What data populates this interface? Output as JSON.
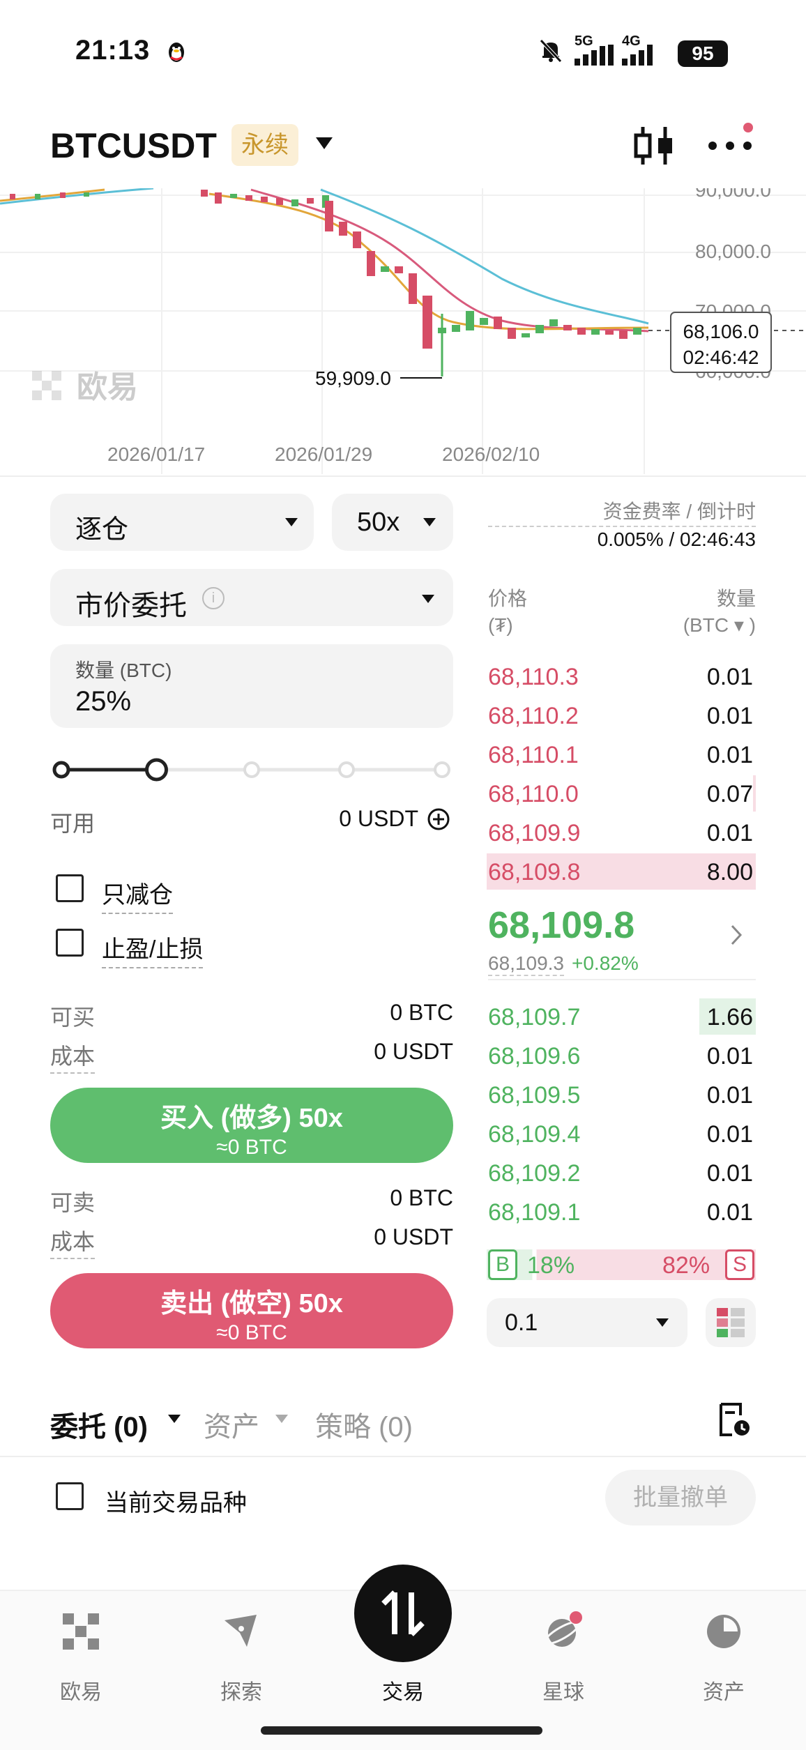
{
  "status_bar": {
    "time": "21:13",
    "network_5g": "5G",
    "network_4g": "4G",
    "battery": "95"
  },
  "header": {
    "pair": "BTCUSDT",
    "badge": "永续"
  },
  "chart": {
    "y_ticks": [
      "90,000.0",
      "80,000.0",
      "70,000.0",
      "60,000.0"
    ],
    "dates": [
      "2026/01/17",
      "2026/01/29",
      "2026/02/10"
    ],
    "low_label": "59,909.0",
    "current_price": "68,106.0",
    "countdown": "02:46:42",
    "watermark": "欧易"
  },
  "order_form": {
    "margin_mode": "逐仓",
    "leverage": "50x",
    "order_type": "市价委托",
    "qty_label": "数量 (BTC)",
    "qty_value": "25%",
    "slider_percent": 25,
    "available_label": "可用",
    "available_value": "0 USDT",
    "reduce_only": "只减仓",
    "tp_sl": "止盈/止损",
    "buy_max_label": "可买",
    "buy_max_value": "0 BTC",
    "buy_cost_label": "成本",
    "buy_cost_value": "0 USDT",
    "buy_button": "买入 (做多) 50x",
    "buy_sub": "≈0 BTC",
    "sell_max_label": "可卖",
    "sell_max_value": "0 BTC",
    "sell_cost_label": "成本",
    "sell_cost_value": "0 USDT",
    "sell_button": "卖出 (做空) 50x",
    "sell_sub": "≈0 BTC"
  },
  "order_book": {
    "funding_label": "资金费率 / 倒计时",
    "funding_value": "0.005% / 02:46:43",
    "price_head": "价格",
    "price_unit": "(₮)",
    "qty_head": "数量",
    "qty_unit": "(BTC ▾ )",
    "asks": [
      {
        "price": "68,110.3",
        "qty": "0.01",
        "depth": 0.0
      },
      {
        "price": "68,110.2",
        "qty": "0.01",
        "depth": 0.0
      },
      {
        "price": "68,110.1",
        "qty": "0.01",
        "depth": 0.0
      },
      {
        "price": "68,110.0",
        "qty": "0.07",
        "depth": 0.01
      },
      {
        "price": "68,109.9",
        "qty": "0.01",
        "depth": 0.0
      },
      {
        "price": "68,109.8",
        "qty": "8.00",
        "depth": 1.0
      }
    ],
    "last_price": "68,109.8",
    "mark_price": "68,109.3",
    "change": "+0.82%",
    "bids": [
      {
        "price": "68,109.7",
        "qty": "1.66",
        "depth": 0.21
      },
      {
        "price": "68,109.6",
        "qty": "0.01",
        "depth": 0.0
      },
      {
        "price": "68,109.5",
        "qty": "0.01",
        "depth": 0.0
      },
      {
        "price": "68,109.4",
        "qty": "0.01",
        "depth": 0.0
      },
      {
        "price": "68,109.2",
        "qty": "0.01",
        "depth": 0.0
      },
      {
        "price": "68,109.1",
        "qty": "0.01",
        "depth": 0.0
      }
    ],
    "buy_tag": "B",
    "sell_tag": "S",
    "buy_ratio": "18%",
    "sell_ratio": "82%",
    "buy_ratio_value": 0.18,
    "depth_step": "0.1"
  },
  "orders_section": {
    "tab_orders": "委托 (0)",
    "tab_assets": "资产",
    "tab_strategy": "策略 (0)",
    "current_only": "当前交易品种",
    "batch_cancel": "批量撤单"
  },
  "bottom_nav": {
    "items": [
      "欧易",
      "探索",
      "交易",
      "星球",
      "资产"
    ]
  },
  "colors": {
    "green": "#4fb35f",
    "red": "#d64d66",
    "badge_bg": "#fbefd6",
    "badge_text": "#c8962c"
  }
}
